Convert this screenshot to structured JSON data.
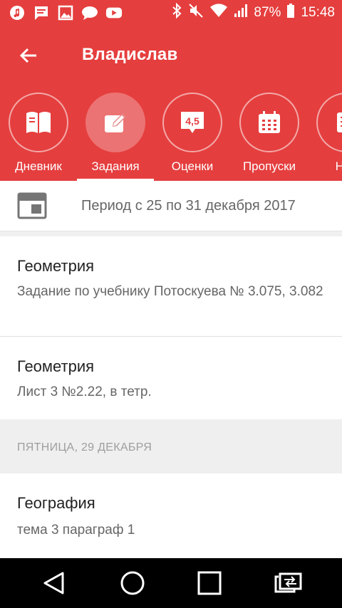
{
  "status_bar": {
    "battery_percent": "87%",
    "time": "15:48",
    "left_icons": [
      "music-icon",
      "message-icon",
      "image-icon",
      "chat-icon",
      "youtube-icon"
    ],
    "right_icons": [
      "bluetooth-icon",
      "mute-icon",
      "wifi-icon",
      "signal-icon",
      "battery-icon"
    ]
  },
  "app_bar": {
    "title": "Владислав",
    "back_icon": "arrow-left-icon"
  },
  "tabs": [
    {
      "label": "Дневник",
      "icon": "book-icon",
      "active": false
    },
    {
      "label": "Задания",
      "icon": "edit-icon",
      "active": true
    },
    {
      "label": "Оценки",
      "icon": "grade-icon",
      "icon_text": "4,5",
      "active": false
    },
    {
      "label": "Пропуски",
      "icon": "calendar-icon",
      "active": false
    },
    {
      "label": "Нов",
      "icon": "news-icon",
      "active": false
    }
  ],
  "period": {
    "text": "Период с 25 по 31 декабря 2017",
    "icon": "calendar-week-icon"
  },
  "assignments": [
    {
      "subject": "Геометрия",
      "description": "Задание по учебнику Потоскуева № 3.075, 3.082"
    },
    {
      "subject": "Геометрия",
      "description": "Лист 3 №2.22, в тетр."
    }
  ],
  "day_header": "ПЯТНИЦА, 29 ДЕКАБРЯ",
  "day_assignments": [
    {
      "subject": "География",
      "description": "тема 3 параграф 1"
    }
  ],
  "nav_bar": {
    "buttons": [
      "back-triangle-icon",
      "home-circle-icon",
      "recents-square-icon",
      "switch-apps-icon"
    ]
  },
  "colors": {
    "primary": "#e53e3e",
    "text_primary": "#222222",
    "text_secondary": "#666666",
    "section_bg": "#efefef"
  }
}
